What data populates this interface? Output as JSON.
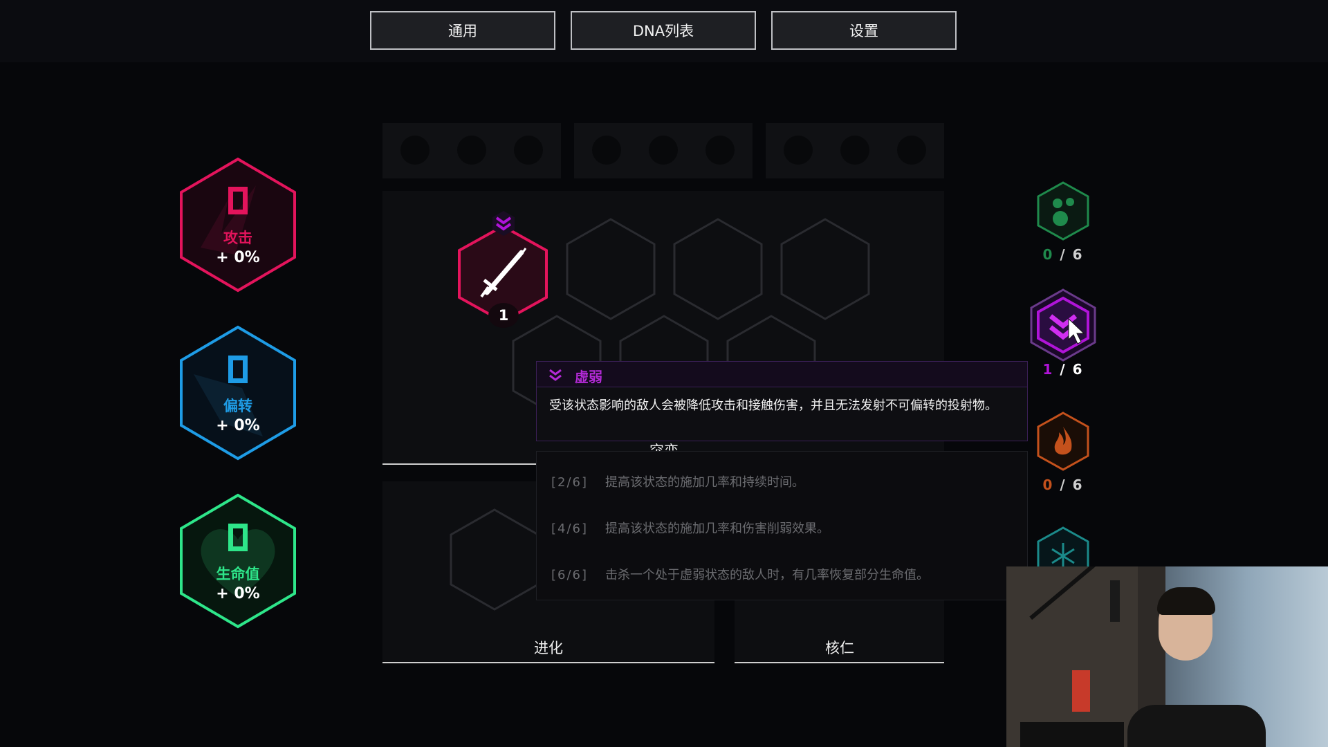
{
  "tabs": [
    {
      "label": "通用"
    },
    {
      "label": "DNA列表"
    },
    {
      "label": "设置"
    }
  ],
  "stats": {
    "attack": {
      "value": "0",
      "label": "攻击",
      "percent": "+ 0%",
      "color": "#e3145c"
    },
    "deflect": {
      "value": "0",
      "label": "偏转",
      "percent": "+ 0%",
      "color": "#1e9ce6"
    },
    "health": {
      "value": "0",
      "label": "生命值",
      "percent": "+ 0%",
      "color": "#2ee68a"
    }
  },
  "equipped_gene": {
    "level": "1",
    "icon": "sword-icon",
    "badge": "weaken-chevron-icon"
  },
  "panels": {
    "mutation_label": "突变",
    "evolution_label": "进化",
    "core_label": "核仁"
  },
  "status_effects": [
    {
      "icon": "bubbles-icon",
      "count": "0",
      "max": "/ 6",
      "color": "#1f8a4c"
    },
    {
      "icon": "weaken-chevron-icon",
      "count": "1",
      "max": "/ 6",
      "color": "#b014d8"
    },
    {
      "icon": "flame-icon",
      "count": "0",
      "max": "/ 6",
      "color": "#c4511c"
    },
    {
      "icon": "snowflake-icon",
      "count": "",
      "max": "",
      "color": "#1b8a8a"
    }
  ],
  "tooltip": {
    "title": "虚弱",
    "description": "受该状态影响的敌人会被降低攻击和接触伤害，并且无法发射不可偏转的投射物。",
    "title_color": "#b32ad6",
    "tiers": [
      {
        "level": "[2/6]",
        "text": "提高该状态的施加几率和持续时间。"
      },
      {
        "level": "[4/6]",
        "text": "提高该状态的施加几率和伤害削弱效果。"
      },
      {
        "level": "[6/6]",
        "text": "击杀一个处于虚弱状态的敌人时，有几率恢复部分生命值。"
      }
    ]
  }
}
